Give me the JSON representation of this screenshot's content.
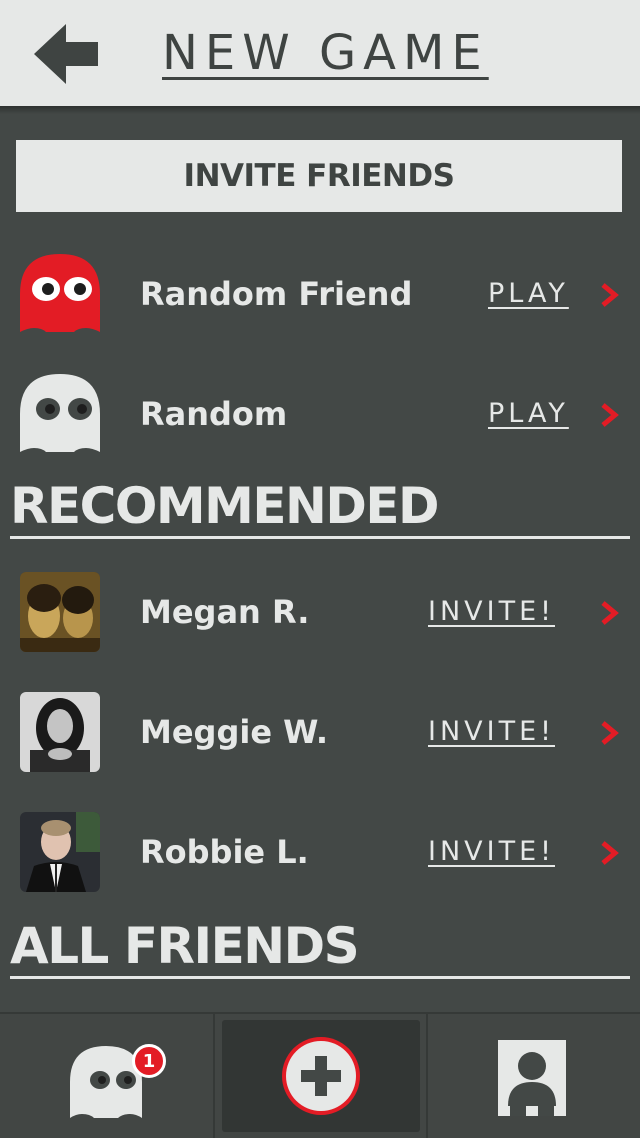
{
  "header": {
    "title": "NEW GAME",
    "back_icon": "arrow-left-icon"
  },
  "invite_button": {
    "label": "INVITE FRIENDS"
  },
  "quick_play": [
    {
      "name": "Random Friend",
      "action": "PLAY",
      "avatar": "red-ghost-icon"
    },
    {
      "name": "Random",
      "action": "PLAY",
      "avatar": "white-ghost-icon"
    }
  ],
  "recommended": {
    "title": "RECOMMENDED",
    "items": [
      {
        "name": "Megan R.",
        "action": "INVITE!"
      },
      {
        "name": "Meggie W.",
        "action": "INVITE!"
      },
      {
        "name": "Robbie L.",
        "action": "INVITE!"
      }
    ]
  },
  "all_friends": {
    "title": "ALL FRIENDS"
  },
  "tabbar": {
    "tabs": [
      {
        "icon": "ghost-icon",
        "badge": "1"
      },
      {
        "icon": "plus-circle-icon"
      },
      {
        "icon": "profile-icon"
      }
    ]
  },
  "colors": {
    "background": "#434846",
    "light": "#e6e8e7",
    "accent_red": "#e31c25"
  }
}
